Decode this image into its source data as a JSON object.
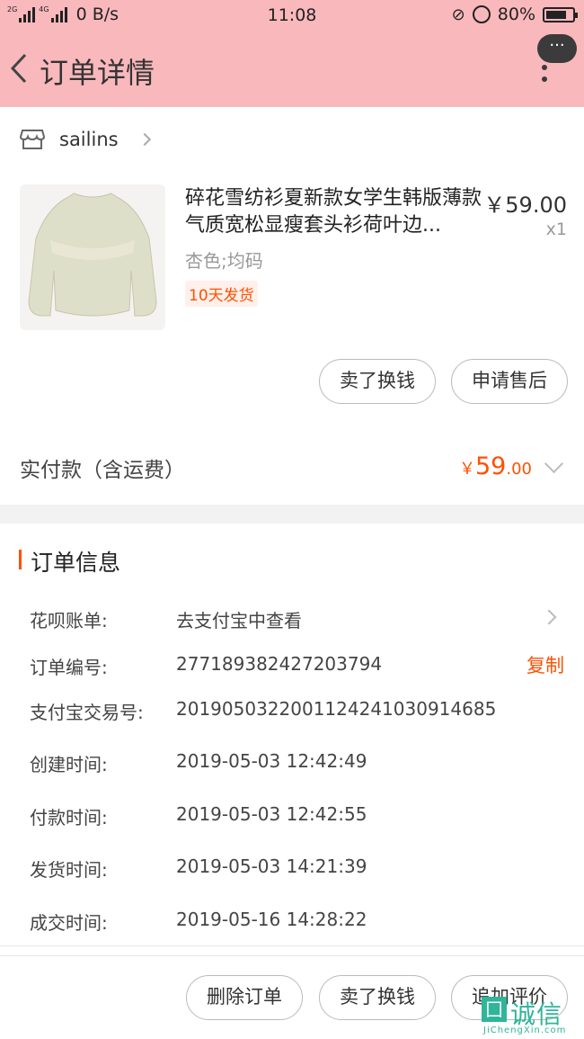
{
  "status_bar": {
    "net_left_1": "2G",
    "net_left_2": "4G",
    "speed": "0 B/s",
    "time": "11:08",
    "battery": "80%",
    "battery_level": 0.8
  },
  "header": {
    "title": "订单详情",
    "more_label": "···",
    "bg_color": "#f9b8bc"
  },
  "shop": {
    "name": "sailins"
  },
  "product": {
    "title": "碎花雪纺衫夏新款女学生韩版薄款气质宽松显瘦套头衫荷叶边...",
    "price": "￥59.00",
    "qty": "x1",
    "sku": "杏色;均码",
    "ship_tag": "10天发货"
  },
  "item_actions": {
    "sell": "卖了换钱",
    "after_sale": "申请售后"
  },
  "payment": {
    "label": "实付款（含运费）",
    "currency": "￥",
    "amount_int": "59",
    "amount_dec": ".00",
    "accent": "#ff5000"
  },
  "order_info": {
    "title": "订单信息",
    "rows": [
      {
        "label": "花呗账单:",
        "value": "去支付宝中查看"
      },
      {
        "label": "订单编号:",
        "value": "277189382427203794"
      },
      {
        "label": "支付宝交易号:",
        "value": "2019050322001124241030914685"
      },
      {
        "label": "创建时间:",
        "value": "2019-05-03 12:42:49"
      },
      {
        "label": "付款时间:",
        "value": "2019-05-03 12:42:55"
      },
      {
        "label": "发货时间:",
        "value": "2019-05-03 14:21:39"
      },
      {
        "label": "成交时间:",
        "value": "2019-05-16 14:28:22"
      }
    ],
    "copy_label": "复制"
  },
  "bottom_actions": {
    "delete": "删除订单",
    "sell": "卖了换钱",
    "review": "追加评价"
  },
  "watermark": {
    "box": "囗",
    "text": "诚信",
    "sub": "JiChengXin.com"
  }
}
